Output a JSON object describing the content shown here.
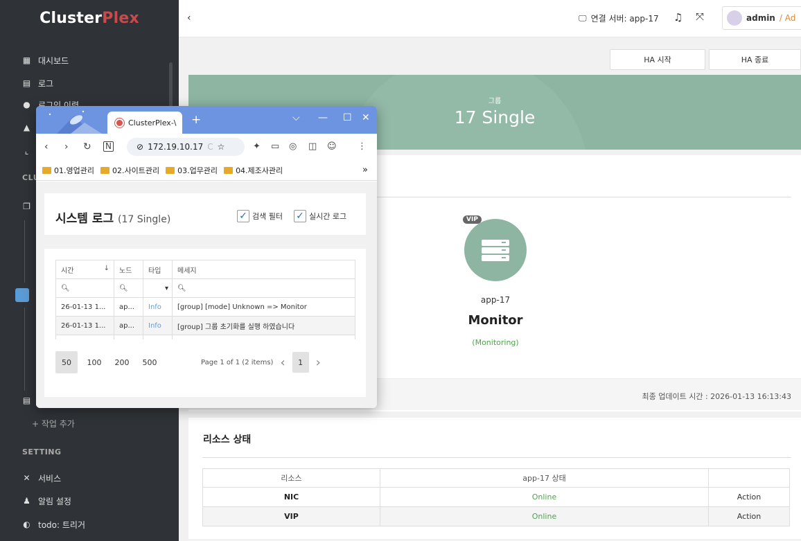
{
  "sidebar": {
    "brand_a": "Cluster",
    "brand_b": "Plex",
    "items": [
      {
        "label": "대시보드",
        "icon": "dashboard-icon"
      },
      {
        "label": "로그",
        "icon": "file-icon"
      },
      {
        "label": "로그인 이력",
        "icon": "users-icon"
      }
    ],
    "partial_section": "CLU",
    "add_job": "+ 작업 추가",
    "setting_section": "SETTING",
    "setting_items": [
      {
        "label": "서비스",
        "icon": "tools-icon"
      },
      {
        "label": "알림 설정",
        "icon": "bell-icon"
      },
      {
        "label": "todo: 트리거",
        "icon": "toggle-icon"
      }
    ]
  },
  "topbar": {
    "back": "‹",
    "server_label": "연결 서버: app-17",
    "user": "admin",
    "role": " / Ad"
  },
  "actions": {
    "ha_start": "HA 시작",
    "ha_stop": "HA 종료"
  },
  "banner": {
    "label": "그룹",
    "title": "17 Single"
  },
  "node": {
    "vip": "VIP",
    "name": "app-17",
    "state": "Monitor",
    "sub": "(Monitoring)",
    "updated": "최종 업데이트 시간 : 2026-01-13 16:13:43"
  },
  "resources": {
    "title": "리소스 상태",
    "headers": [
      "리소스",
      "app-17 상태",
      ""
    ],
    "rows": [
      {
        "name": "NIC",
        "status": "Online",
        "action": "Action"
      },
      {
        "name": "VIP",
        "status": "Online",
        "action": "Action"
      }
    ]
  },
  "browser": {
    "tab_title": "ClusterPlex-\\",
    "url": "172.19.10.17",
    "url_fade": "C",
    "bookmarks": [
      "01.영업관리",
      "02.사이트관리",
      "03.업무관리",
      "04.제조사관리"
    ],
    "more": "»"
  },
  "syslog": {
    "title": "시스템 로그",
    "subtitle": "(17 Single)",
    "filter_label": "검색 필터",
    "realtime_label": "실시간 로그",
    "columns": [
      "시간",
      "노드",
      "타입",
      "메세지"
    ],
    "rows": [
      {
        "time": "26-01-13 1...",
        "node": "ap...",
        "type": "Info",
        "msg": "[group] [mode] Unknown => Monitor"
      },
      {
        "time": "26-01-13 1...",
        "node": "ap...",
        "type": "Info",
        "msg": "[group] 그룹 초기화를 실행 하였습니다"
      }
    ],
    "page_sizes": [
      "50",
      "100",
      "200",
      "500"
    ],
    "page_info": "Page 1 of 1 (2 items)",
    "current_page": "1"
  }
}
